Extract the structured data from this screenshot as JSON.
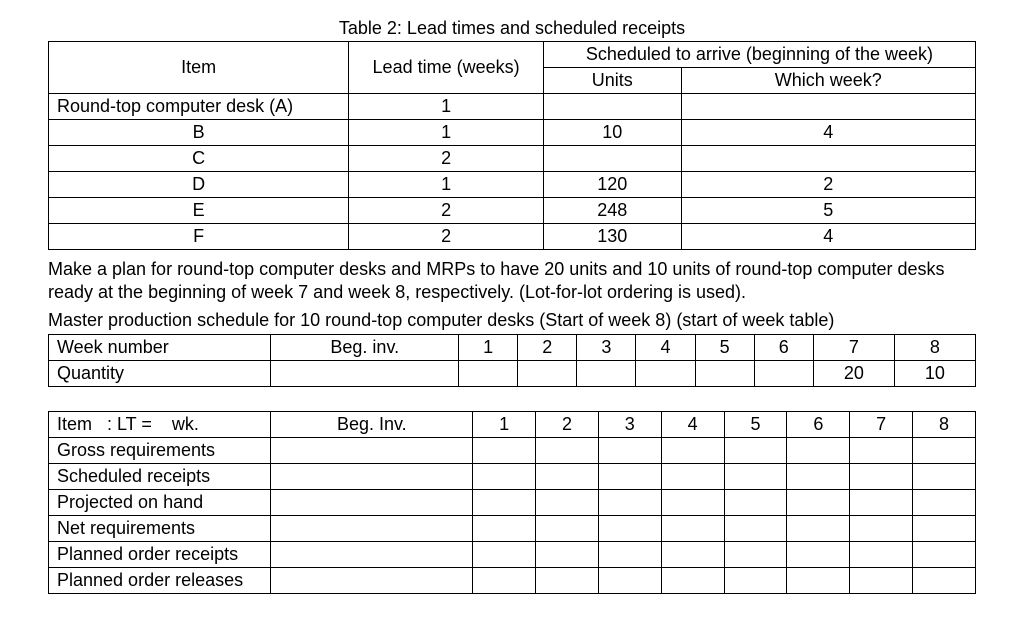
{
  "table2": {
    "caption": "Table 2: Lead times and scheduled receipts",
    "headers": {
      "item": "Item",
      "lead_time": "Lead time (weeks)",
      "scheduled": "Scheduled to arrive (beginning of the week)",
      "units": "Units",
      "which_week": "Which week?"
    },
    "rows": [
      {
        "item": "Round-top computer desk (A)",
        "lead": "1",
        "units": "",
        "week": ""
      },
      {
        "item": "B",
        "lead": "1",
        "units": "10",
        "week": "4"
      },
      {
        "item": "C",
        "lead": "2",
        "units": "",
        "week": ""
      },
      {
        "item": "D",
        "lead": "1",
        "units": "120",
        "week": "2"
      },
      {
        "item": "E",
        "lead": "2",
        "units": "248",
        "week": "5"
      },
      {
        "item": "F",
        "lead": "2",
        "units": "130",
        "week": "4"
      }
    ]
  },
  "paragraph1": "Make a plan for round-top computer desks and MRPs to have 20 units and 10 units of round-top computer desks ready at the beginning of week 7 and week 8, respectively. (Lot-for-lot ordering is used).",
  "paragraph2": "Master production schedule for 10 round-top computer desks (Start of week 8) (start of week table)",
  "mps": {
    "row_labels": {
      "week_number": "Week number",
      "quantity": "Quantity"
    },
    "beg_inv": "Beg. inv.",
    "weeks": [
      "1",
      "2",
      "3",
      "4",
      "5",
      "6",
      "7",
      "8"
    ],
    "quantity": [
      "",
      "",
      "",
      "",
      "",
      "",
      "20",
      "10"
    ]
  },
  "mrp": {
    "header_label": "Item   : LT =    wk.",
    "beg_inv": "Beg. Inv.",
    "weeks": [
      "1",
      "2",
      "3",
      "4",
      "5",
      "6",
      "7",
      "8"
    ],
    "rows": [
      "Gross requirements",
      "Scheduled receipts",
      "Projected on hand",
      "Net requirements",
      "Planned order receipts",
      "Planned order releases"
    ]
  },
  "chart_data": {
    "type": "table",
    "tables": [
      {
        "title": "Lead times and scheduled receipts",
        "columns": [
          "Item",
          "Lead time (weeks)",
          "Units",
          "Which week?"
        ],
        "rows": [
          [
            "Round-top computer desk (A)",
            1,
            null,
            null
          ],
          [
            "B",
            1,
            10,
            4
          ],
          [
            "C",
            2,
            null,
            null
          ],
          [
            "D",
            1,
            120,
            2
          ],
          [
            "E",
            2,
            248,
            5
          ],
          [
            "F",
            2,
            130,
            4
          ]
        ]
      },
      {
        "title": "Master production schedule",
        "columns": [
          "Week number",
          "Beg. inv.",
          "1",
          "2",
          "3",
          "4",
          "5",
          "6",
          "7",
          "8"
        ],
        "rows": [
          [
            "Quantity",
            null,
            null,
            null,
            null,
            null,
            null,
            null,
            20,
            10
          ]
        ]
      }
    ]
  }
}
